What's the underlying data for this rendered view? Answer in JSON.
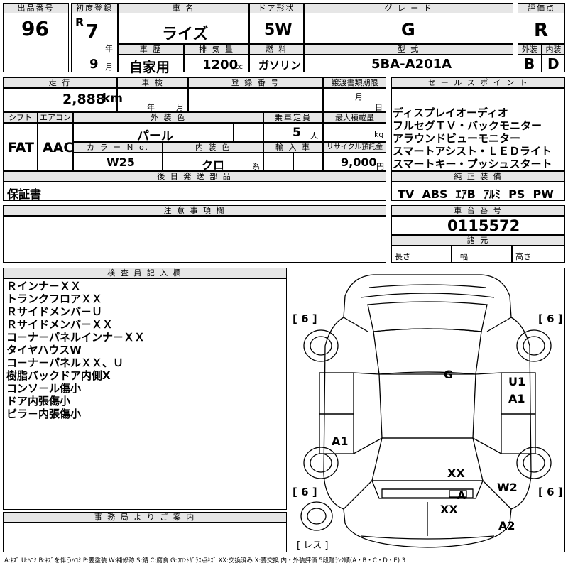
{
  "header": {
    "lot_label": "出品番号",
    "lot_value": "96",
    "first_reg_label": "初度登録",
    "era": "R",
    "year": "7",
    "year_unit": "年",
    "month": "9",
    "month_unit": "月",
    "name_label": "車 名",
    "name_value": "ライズ",
    "door_label": "ドア形状",
    "door_value": "5W",
    "grade_label": "グ レ ー ド",
    "grade_value": "G",
    "score_label": "評価点",
    "score_value": "R",
    "history_label": "車 歴",
    "history_value": "自家用",
    "displacement_label": "排 気 量",
    "displacement_value": "1200",
    "displacement_unit": "cc",
    "fuel_label": "燃 料",
    "fuel_value": "ガソリン",
    "model_label": "型 式",
    "model_value": "5BA-A201A",
    "exterior_label": "外装",
    "exterior_value": "B",
    "interior_label": "内装",
    "interior_value": "D"
  },
  "row2": {
    "mileage_label": "走 行",
    "mileage_value": "2,888",
    "mileage_unit": "km",
    "inspection_label": "車 検",
    "inspection_year_unit": "年",
    "inspection_month_unit": "月",
    "reg_label": "登 録 番 号",
    "transfer_label": "譲渡書類期限",
    "transfer_month_unit": "月",
    "transfer_day_unit": "日",
    "sales_label": "セ ー ル ス ポ イ ン ト",
    "sales_points": [
      "ディスプレイオーディオ",
      "フルセグＴＶ・バックモニター",
      "アラウンドビューモニター",
      "スマートアシスト・ＬＥＤライト",
      "スマートキー・プッシュスタート"
    ]
  },
  "row3": {
    "shift_label": "シフト",
    "shift_value": "FAT",
    "ac_label": "エアコン",
    "ac_value": "AAC",
    "color_label": "外 装 色",
    "color_value": "パール",
    "seats_label": "乗車定員",
    "seats_value": "5",
    "seats_unit": "人",
    "load_label": "最大積載量",
    "load_unit": "kg",
    "colorno_label": "カ ラ ー Ｎ o.",
    "colorno_value": "W25",
    "intcolor_label": "内 装 色",
    "intcolor_value": "クロ",
    "intcolor_unit": "系",
    "import_label": "輸 入 車",
    "recycle_label": "リサイクル預託金",
    "recycle_value": "9,000",
    "recycle_unit": "円",
    "later_label": "後 日 発 送 部 品",
    "later_value": "保証書",
    "equip_label": "純 正 装 備",
    "equip_value": "TV  ABS  ｴｱB  ｱﾙﾐ  PS  PW"
  },
  "notes": {
    "caution_label": "注 意 事 項 欄",
    "chassis_label": "車 台 番 号",
    "chassis_value": "0115572",
    "specs_label": "諸 元",
    "len_label": "長さ",
    "width_label": "幅",
    "height_label": "高さ"
  },
  "inspector": {
    "label": "検 査 員 記 入 欄",
    "items": [
      "Ｒインナ－ＸＸ",
      "トランクフロアＸＸ",
      "Ｒサイドメンバ－Ｕ",
      "Ｒサイドメンバ－ＸＸ",
      "コ－ナ－パネルインナ－ＸＸ",
      "タイヤハウスW",
      "コ－ナ－パネルＸＸ、Ｕ",
      "樹脂バックドア内側X",
      "コンソ－ル傷小",
      "ドア内張傷小",
      "ピラ－内張傷小"
    ]
  },
  "office": {
    "label": "事 務 局 よ り ご 案 内"
  },
  "diagram": {
    "tires": [
      "[ 6 ]",
      "[ 6 ]",
      "[ 6 ]",
      "[ 6 ]"
    ],
    "marks": {
      "G": "G",
      "U1": "U1",
      "A1r": "A1",
      "A1l": "A1",
      "XX1": "XX",
      "W2": "W2",
      "A": "A",
      "XX2": "XX",
      "A2": "A2"
    },
    "spare": "[ レス ]"
  },
  "legend": "A:ｷｽﾞ  U:ﾍｺﾐ  B:ｷｽﾞを伴うﾍｺﾐ  P:要塗装  W:補修跡  S:錆  C:腐食  G:ﾌﾛﾝﾄｶﾞﾗｽ点ｷｽﾞ  XX:交換済み  X:要交換   内・外装評価  5段階ﾗﾝｸ順(A・B・C・D・E) 3"
}
